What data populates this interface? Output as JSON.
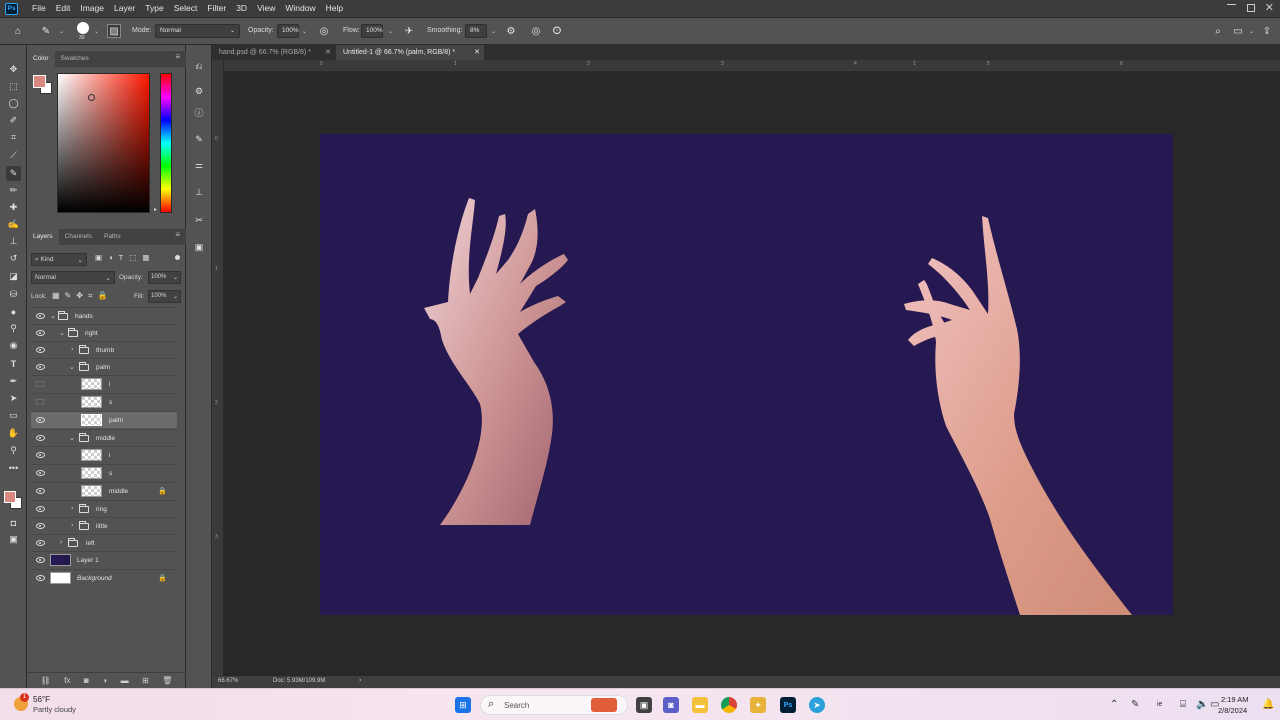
{
  "app": {
    "logo": "Ps"
  },
  "menu": [
    "File",
    "Edit",
    "Image",
    "Layer",
    "Type",
    "Select",
    "Filter",
    "3D",
    "View",
    "Window",
    "Help"
  ],
  "options": {
    "brush_size": "30",
    "mode_label": "Mode:",
    "mode_value": "Normal",
    "opacity_label": "Opacity:",
    "opacity_value": "100%",
    "flow_label": "Flow:",
    "flow_value": "100%",
    "smoothing_label": "Smoothing:",
    "smoothing_value": "8%"
  },
  "color_panel": {
    "tabs": [
      "Color",
      "Swatches"
    ],
    "foreground": "#d98a80",
    "background": "#ffffff"
  },
  "layers_panel": {
    "tabs": [
      "Layers",
      "Channels",
      "Paths"
    ],
    "filter": "Kind",
    "blend_mode": "Normal",
    "opacity_label": "Opacity:",
    "opacity_value": "100%",
    "lock_label": "Lock:",
    "fill_label": "Fill:",
    "fill_value": "100%",
    "layers": [
      {
        "name": "hands"
      },
      {
        "name": "right"
      },
      {
        "name": "thumb"
      },
      {
        "name": "palm"
      },
      {
        "name": "i"
      },
      {
        "name": "s"
      },
      {
        "name": "palm"
      },
      {
        "name": "middle"
      },
      {
        "name": "i"
      },
      {
        "name": "s"
      },
      {
        "name": "middle"
      },
      {
        "name": "ring"
      },
      {
        "name": "little"
      },
      {
        "name": "left"
      },
      {
        "name": "Layer 1"
      },
      {
        "name": "Background"
      }
    ]
  },
  "documents": [
    {
      "title": "hand.psd @ 66.7% (RGB/8) *"
    },
    {
      "title": "Untitled-1 @ 66.7% (palm, RGB/8) *"
    }
  ],
  "ruler_top": [
    "0",
    "1",
    "2",
    "3",
    "4",
    "1",
    "5",
    "6"
  ],
  "ruler_left": [
    "0",
    "1",
    "2",
    "3"
  ],
  "canvas": {
    "background": "#261850",
    "skin": "#d99a88"
  },
  "status": {
    "zoom": "66.67%",
    "doc": "Doc: 5.93M/109.9M"
  },
  "taskbar": {
    "weather_temp": "56°F",
    "weather_desc": "Partly cloudy",
    "weather_badge": "1",
    "search_placeholder": "Search",
    "tray_lang": "ie",
    "time": "2:19 AM",
    "date": "2/8/2024"
  }
}
